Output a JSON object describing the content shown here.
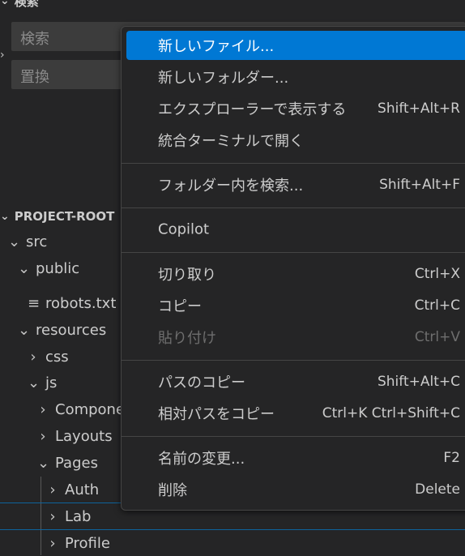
{
  "search": {
    "section_title": "検索",
    "search_placeholder": "検索",
    "replace_placeholder": "置換"
  },
  "explorer": {
    "section_title": "PROJECT-ROOT",
    "items": [
      {
        "label": "src",
        "icon": "chevron-down"
      },
      {
        "label": "public",
        "icon": "chevron-down"
      },
      {
        "label": "robots.txt",
        "icon": "lines"
      },
      {
        "label": "resources",
        "icon": "chevron-down"
      },
      {
        "label": "css",
        "icon": "chevron-right"
      },
      {
        "label": "js",
        "icon": "chevron-down"
      },
      {
        "label": "Components",
        "icon": "chevron-right"
      },
      {
        "label": "Layouts",
        "icon": "chevron-right"
      },
      {
        "label": "Pages",
        "icon": "chevron-down"
      },
      {
        "label": "Auth",
        "icon": "chevron-right"
      },
      {
        "label": "Lab",
        "icon": "chevron-right"
      },
      {
        "label": "Profile",
        "icon": "chevron-right"
      }
    ]
  },
  "context_menu": {
    "groups": [
      [
        {
          "label": "新しいファイル...",
          "shortcut": "",
          "active": true
        },
        {
          "label": "新しいフォルダー...",
          "shortcut": ""
        },
        {
          "label": "エクスプローラーで表示する",
          "shortcut": "Shift+Alt+R"
        },
        {
          "label": "統合ターミナルで開く",
          "shortcut": ""
        }
      ],
      [
        {
          "label": "フォルダー内を検索...",
          "shortcut": "Shift+Alt+F"
        }
      ],
      [
        {
          "label": "Copilot",
          "shortcut": ""
        }
      ],
      [
        {
          "label": "切り取り",
          "shortcut": "Ctrl+X"
        },
        {
          "label": "コピー",
          "shortcut": "Ctrl+C"
        },
        {
          "label": "貼り付け",
          "shortcut": "Ctrl+V",
          "disabled": true
        }
      ],
      [
        {
          "label": "パスのコピー",
          "shortcut": "Shift+Alt+C"
        },
        {
          "label": "相対パスをコピー",
          "shortcut": "Ctrl+K Ctrl+Shift+C"
        }
      ],
      [
        {
          "label": "名前の変更...",
          "shortcut": "F2"
        },
        {
          "label": "削除",
          "shortcut": "Delete"
        }
      ]
    ]
  },
  "colors": {
    "background": "#252526",
    "menu_highlight": "#0078d4",
    "input_background": "#3c3c3c",
    "focus_border": "#0e639c"
  }
}
